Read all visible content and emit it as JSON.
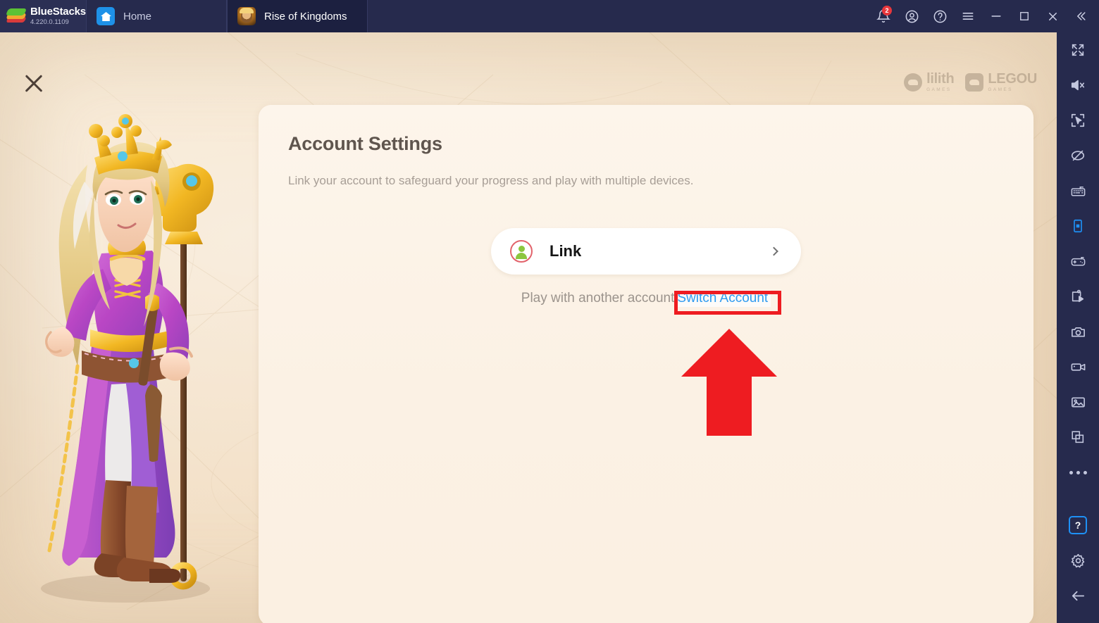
{
  "titlebar": {
    "brand_name": "BlueStacks",
    "version": "4.220.0.1109",
    "tabs": [
      {
        "label": "Home",
        "icon": "home-icon",
        "active": false
      },
      {
        "label": "Rise of Kingdoms",
        "icon": "rise-of-kingdoms-app-icon",
        "active": true
      }
    ],
    "controls": [
      {
        "name": "notifications-button",
        "icon": "bell-icon",
        "badge": "2"
      },
      {
        "name": "account-button",
        "icon": "user-circle-icon",
        "badge": ""
      },
      {
        "name": "help-button",
        "icon": "question-circle-icon",
        "badge": ""
      },
      {
        "name": "menu-button",
        "icon": "hamburger-menu-icon",
        "badge": ""
      },
      {
        "name": "minimize-button",
        "icon": "minimize-icon",
        "badge": ""
      },
      {
        "name": "maximize-button",
        "icon": "maximize-icon",
        "badge": ""
      },
      {
        "name": "close-button",
        "icon": "close-icon",
        "badge": ""
      },
      {
        "name": "collapse-button",
        "icon": "double-chevron-left-icon",
        "badge": ""
      }
    ]
  },
  "game": {
    "close_label": "",
    "watermarks": [
      {
        "main": "lilith",
        "sub": "GAMES"
      },
      {
        "main": "LEGOU",
        "sub": "GAMES"
      }
    ],
    "panel": {
      "title": "Account Settings",
      "subtitle": "Link your account to safeguard your progress and play with multiple devices.",
      "link_button_label": "Link",
      "play_with_another_text": "Play with another account",
      "switch_account_label": "Switch Account"
    }
  },
  "annotations": {
    "highlight_color": "#EE1C21",
    "highlight_target": "switch-account-link",
    "arrow_direction": "up"
  },
  "sidebar": {
    "items": [
      {
        "name": "fullscreen-button",
        "icon": "fullscreen-expand-icon"
      },
      {
        "name": "mute-button",
        "icon": "volume-mute-icon"
      },
      {
        "name": "cursor-lock-button",
        "icon": "cursor-target-icon"
      },
      {
        "name": "disable-ads-button",
        "icon": "eye-off-icon"
      },
      {
        "name": "keyboard-controls-button",
        "icon": "keyboard-icon"
      },
      {
        "name": "instance-orientation-button",
        "icon": "phone-screen-icon"
      },
      {
        "name": "gamepad-controls-button",
        "icon": "gamepad-icon"
      },
      {
        "name": "macro-recorder-button",
        "icon": "script-play-icon"
      },
      {
        "name": "screenshot-button",
        "icon": "camera-icon"
      },
      {
        "name": "screen-record-button",
        "icon": "video-camera-icon"
      },
      {
        "name": "media-manager-button",
        "icon": "gallery-image-icon"
      },
      {
        "name": "multi-instance-button",
        "icon": "copy-windows-icon"
      },
      {
        "name": "more-options-button",
        "icon": "ellipsis-icon"
      }
    ],
    "bottom_items": [
      {
        "name": "help-center-button",
        "icon": "question-mark-icon",
        "label": "?",
        "highlighted": true
      },
      {
        "name": "settings-button",
        "icon": "gear-icon",
        "label": "",
        "highlighted": false
      },
      {
        "name": "back-button",
        "icon": "arrow-left-icon",
        "label": "",
        "highlighted": false
      }
    ]
  }
}
